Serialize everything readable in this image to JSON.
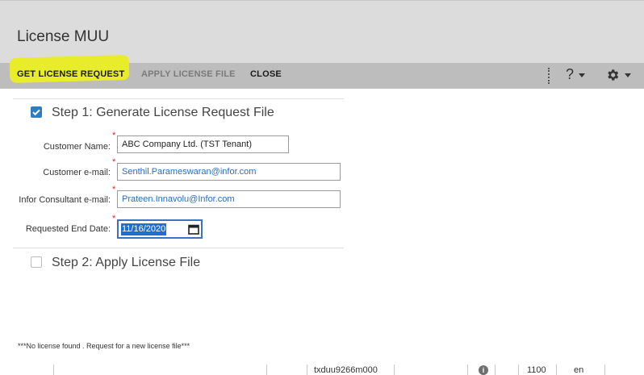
{
  "window": {
    "title": "License MUU"
  },
  "toolbar": {
    "get_license_request": "GET LICENSE REQUEST",
    "apply_license_file": "APPLY LICENSE FILE",
    "close": "CLOSE",
    "help_label": "?",
    "highlight_color": "#e8ec2a"
  },
  "step1": {
    "label": "Step 1: Generate License Request File",
    "checked": true,
    "fields": {
      "customer_name": {
        "label": "Customer Name:",
        "value": "ABC Company Ltd. (TST Tenant)"
      },
      "customer_email": {
        "label": "Customer e-mail:",
        "value": "Senthil.Parameswaran@infor.com"
      },
      "consultant_email": {
        "label": "Infor Consultant e-mail:",
        "value": "Prateen.Innavolu@Infor.com"
      },
      "end_date": {
        "label": "Requested End Date:",
        "value": "11/16/2020"
      }
    },
    "required_marker": "*"
  },
  "step2": {
    "label": "Step 2: Apply License File",
    "checked": false
  },
  "message": "***No license found . Request for a new license file***",
  "status_bar": {
    "session": "txduu9266m000",
    "company": "1100",
    "language": "en",
    "info_icon": "i"
  },
  "icons": {
    "checkbox_checked": "checkbox-checked-icon",
    "checkbox_unchecked": "checkbox-unchecked-icon",
    "calendar": "calendar-icon",
    "gear": "gear-icon",
    "help": "help-icon",
    "info": "info-icon"
  },
  "colors": {
    "accent": "#2f7dc1",
    "link": "#2a6ebb",
    "required": "#d9261c",
    "toolbar": "#bdbdbd",
    "titlebar": "#dcdcdc"
  }
}
